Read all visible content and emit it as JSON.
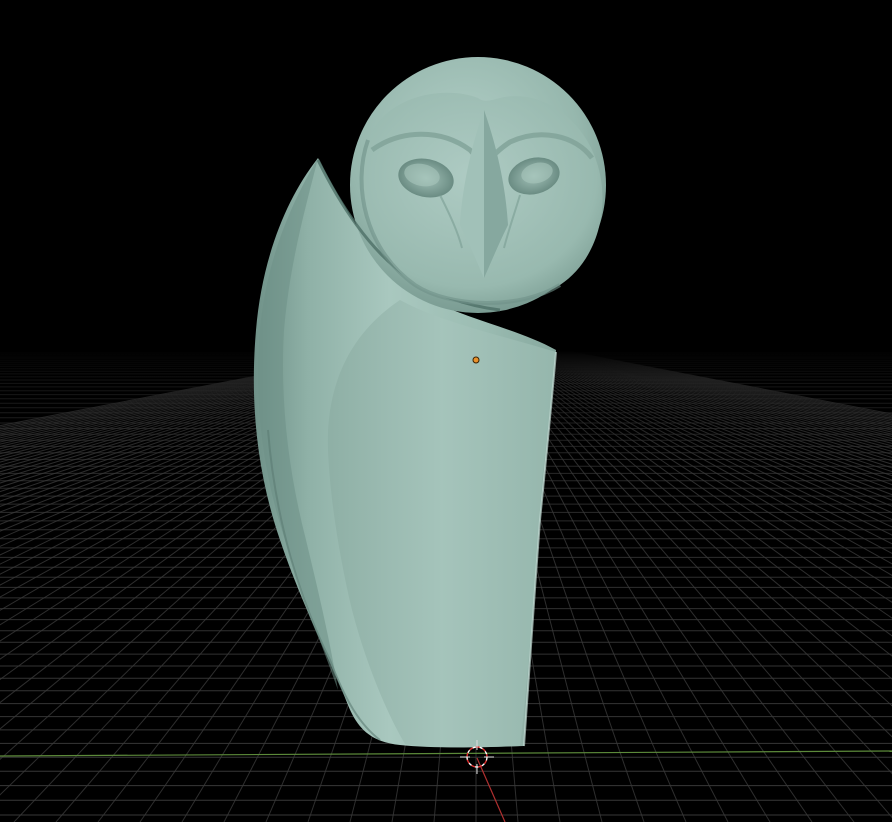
{
  "viewport": {
    "background": "#000000",
    "grid_color": "#3a3a3a",
    "x_axis_color": "#5c8a3a",
    "y_axis_color": "#b03030"
  },
  "model": {
    "type": "sculpt-mesh",
    "color": "#92b5ab",
    "shade_dark": "#5e7f76",
    "shade_light": "#b7d1c9"
  },
  "origin_marker": {
    "color": "#e8902a"
  },
  "cursor_3d": {
    "color_a": "#ffffff",
    "color_b": "#e03030"
  },
  "icons": [
    "3d-cursor-icon",
    "object-origin-icon"
  ]
}
